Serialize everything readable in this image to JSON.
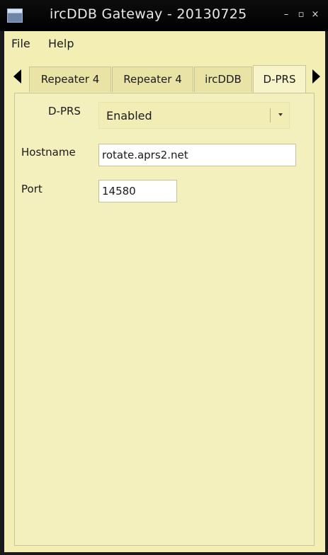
{
  "window": {
    "title": "ircDDB Gateway - 20130725",
    "minimize_glyph": "–",
    "maximize_glyph": "▫",
    "close_glyph": "×"
  },
  "menu": {
    "items": [
      {
        "label": "File"
      },
      {
        "label": "Help"
      }
    ]
  },
  "tabs": {
    "items": [
      {
        "label": "Repeater 4"
      },
      {
        "label": "Repeater 4"
      },
      {
        "label": "ircDDB"
      },
      {
        "label": "D-PRS",
        "active": true
      }
    ],
    "scroll_left_icon": "triangle-left-icon",
    "scroll_right_icon": "triangle-right-icon"
  },
  "form": {
    "dprs_label": "D-PRS",
    "dprs_value": "Enabled",
    "hostname_label": "Hostname",
    "hostname_value": "rotate.aprs2.net",
    "port_label": "Port",
    "port_value": "14580"
  },
  "colors": {
    "background": "#f2eeb4",
    "titlebar": "#000000",
    "active_tab": "#f7f4c9"
  }
}
